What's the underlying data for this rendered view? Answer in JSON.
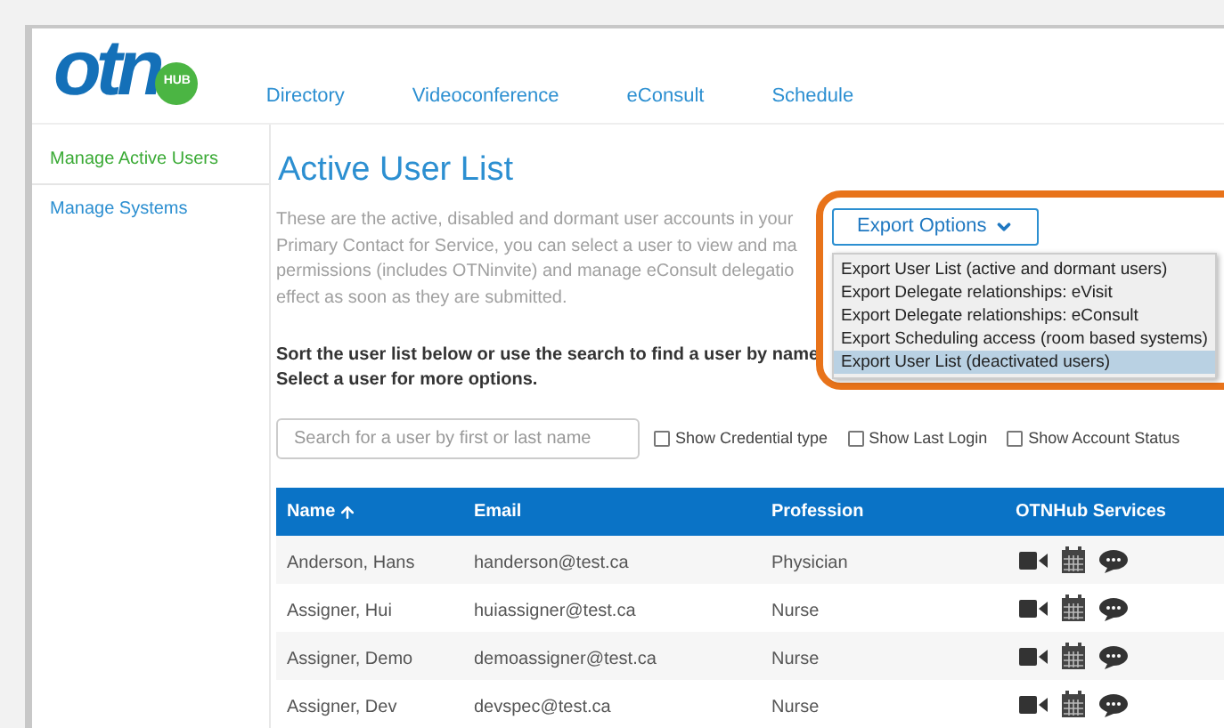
{
  "logo": {
    "text": "otn",
    "badge": "HUB"
  },
  "nav": [
    "Directory",
    "Videoconference",
    "eConsult",
    "Schedule"
  ],
  "sidebar": {
    "items": [
      {
        "label": "Manage Active Users",
        "selected": true
      },
      {
        "label": "Manage Systems",
        "selected": false
      }
    ]
  },
  "title": "Active User List",
  "intro_lines": [
    "These are the active, disabled and dormant user accounts in your",
    "Primary Contact for Service, you can select a user to view and ma",
    "permissions (includes OTNinvite) and manage eConsult delegatio",
    "effect as soon as they are submitted."
  ],
  "instructions": [
    "Sort the user list below or use the search to find a user by name",
    "Select a user for more options."
  ],
  "export": {
    "label": "Export Options",
    "items": [
      {
        "label": "Export User List (active and dormant users)",
        "selected": false
      },
      {
        "label": "Export Delegate relationships: eVisit",
        "selected": false
      },
      {
        "label": "Export Delegate relationships: eConsult",
        "selected": false
      },
      {
        "label": "Export Scheduling access (room based systems)",
        "selected": false
      },
      {
        "label": "Export User List (deactivated users)",
        "selected": true
      }
    ]
  },
  "search": {
    "placeholder": "Search for a user by first or last name"
  },
  "options": [
    {
      "label": "Show Credential type",
      "checked": false
    },
    {
      "label": "Show Last Login",
      "checked": false
    },
    {
      "label": "Show Account Status",
      "checked": false
    }
  ],
  "table": {
    "columns": [
      {
        "label": "Name",
        "sorted": true
      },
      {
        "label": "Email",
        "sorted": false
      },
      {
        "label": "Profession",
        "sorted": false
      },
      {
        "label": "OTNHub Services",
        "sorted": false
      }
    ],
    "rows": [
      {
        "name": "Anderson, Hans",
        "email": "handerson@test.ca",
        "profession": "Physician"
      },
      {
        "name": "Assigner, Hui",
        "email": "huiassigner@test.ca",
        "profession": "Nurse"
      },
      {
        "name": "Assigner, Demo",
        "email": "demoassigner@test.ca",
        "profession": "Nurse"
      },
      {
        "name": "Assigner, Dev",
        "email": "devspec@test.ca",
        "profession": "Nurse"
      }
    ]
  }
}
